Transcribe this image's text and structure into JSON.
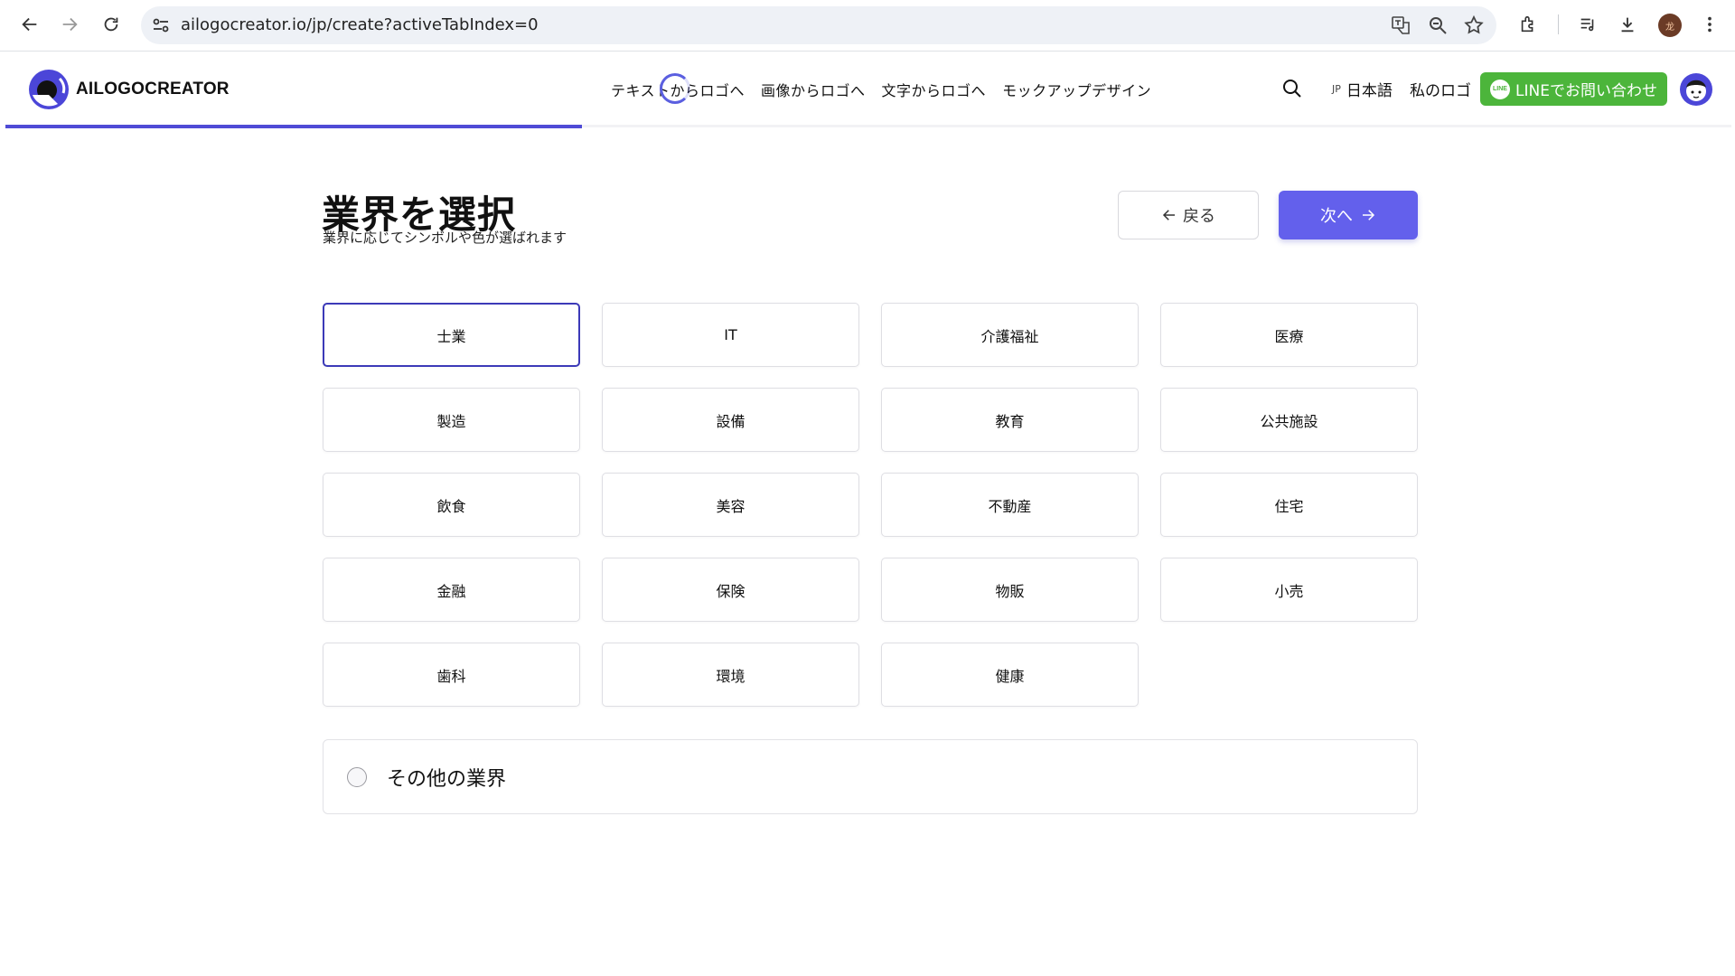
{
  "browser": {
    "url": "ailogocreator.io/jp/create?activeTabIndex=0",
    "profile_initial": "龙"
  },
  "header": {
    "logo_text": "AILOGOCREATOR",
    "nav": [
      {
        "label": "テキストからロゴへ"
      },
      {
        "label": "画像からロゴへ"
      },
      {
        "label": "文字からロゴへ"
      },
      {
        "label": "モックアップデザイン"
      }
    ],
    "lang_code": "JP",
    "lang_label": "日本語",
    "my_logo": "私のロゴ",
    "line_icon_text": "LINE",
    "line_button": "LINEでお問い合わせ",
    "progress_fraction": 0.334
  },
  "colors": {
    "accent": "#6360ec",
    "progress": "#4f4bd6",
    "line_green": "#4cb53b",
    "selected_border": "#3c3ab8"
  },
  "main": {
    "title": "業界を選択",
    "subtitle": "業界に応じてシンボルや色が選ばれます",
    "back_label": "戻る",
    "next_label": "次へ",
    "industries": [
      {
        "label": "士業",
        "selected": true
      },
      {
        "label": "IT",
        "selected": false
      },
      {
        "label": "介護福祉",
        "selected": false
      },
      {
        "label": "医療",
        "selected": false
      },
      {
        "label": "製造",
        "selected": false
      },
      {
        "label": "設備",
        "selected": false
      },
      {
        "label": "教育",
        "selected": false
      },
      {
        "label": "公共施設",
        "selected": false
      },
      {
        "label": "飲食",
        "selected": false
      },
      {
        "label": "美容",
        "selected": false
      },
      {
        "label": "不動産",
        "selected": false
      },
      {
        "label": "住宅",
        "selected": false
      },
      {
        "label": "金融",
        "selected": false
      },
      {
        "label": "保険",
        "selected": false
      },
      {
        "label": "物販",
        "selected": false
      },
      {
        "label": "小売",
        "selected": false
      },
      {
        "label": "歯科",
        "selected": false
      },
      {
        "label": "環境",
        "selected": false
      },
      {
        "label": "健康",
        "selected": false
      }
    ],
    "other_label": "その他の業界",
    "other_checked": false
  }
}
